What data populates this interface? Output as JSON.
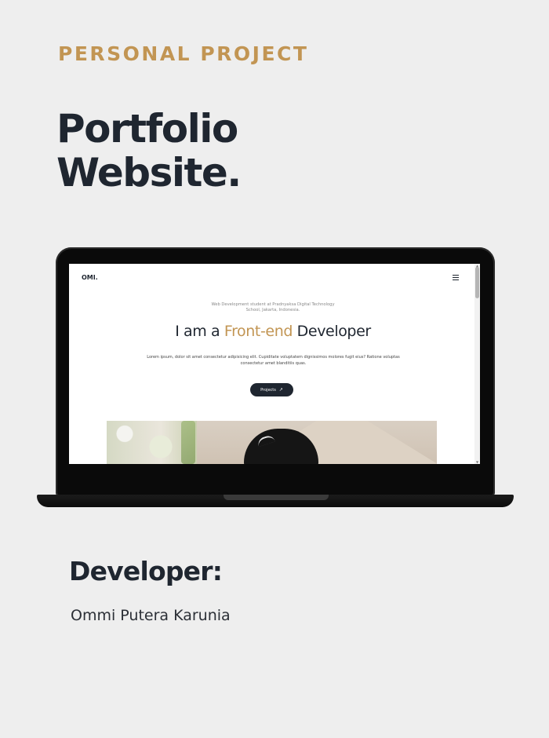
{
  "eyebrow": "PERSONAL PROJECT",
  "headline": {
    "line1": "Portfolio",
    "line2": "Website."
  },
  "site": {
    "logo": "OMI.",
    "subtitle_line1": "Web Development student at Pradnyaksa Digital Technology",
    "subtitle_line2": "School, Jakarta, Indonesia.",
    "heading_prefix": "I am a ",
    "heading_accent": "Front-end",
    "heading_suffix": " Developer",
    "description": "Lorem ipsum, dolor sit amet consectetur adipisicing elit. Cupiditate voluptatem dignissimos molores fugit eius? Ratione voluptas consectetur amet blanditiis quas.",
    "button_label": "Projects",
    "button_icon": "arrow-up-right-icon",
    "menu_icon": "hamburger-menu-icon"
  },
  "developer": {
    "label": "Developer:",
    "name": "Ommi Putera Karunia"
  },
  "colors": {
    "background": "#eeeeee",
    "accent": "#c29553",
    "dark": "#1f2630"
  }
}
